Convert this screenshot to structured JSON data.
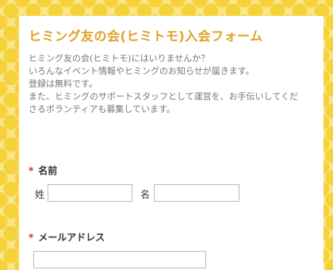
{
  "form": {
    "title": "ヒミング友の会(ヒミトモ)入会フォーム",
    "intro": [
      "ヒミング友の会(ヒミトモ)にはいりませんか？",
      "いろんなイベント情報やヒミングのお知らせが届きます。",
      "登録は無料です。",
      "また、ヒミングのサポートスタッフとして運営を、お手伝いしてくだ",
      "さるボランティアも募集しています。"
    ],
    "required_mark": "*",
    "name": {
      "label": "名前",
      "last_label": "姓",
      "first_label": "名",
      "last_value": "",
      "first_value": ""
    },
    "email": {
      "label": "メールアドレス",
      "value": ""
    }
  },
  "colors": {
    "title": "#e0a125",
    "required": "#d22222",
    "background_dot": "#f6d23a"
  }
}
